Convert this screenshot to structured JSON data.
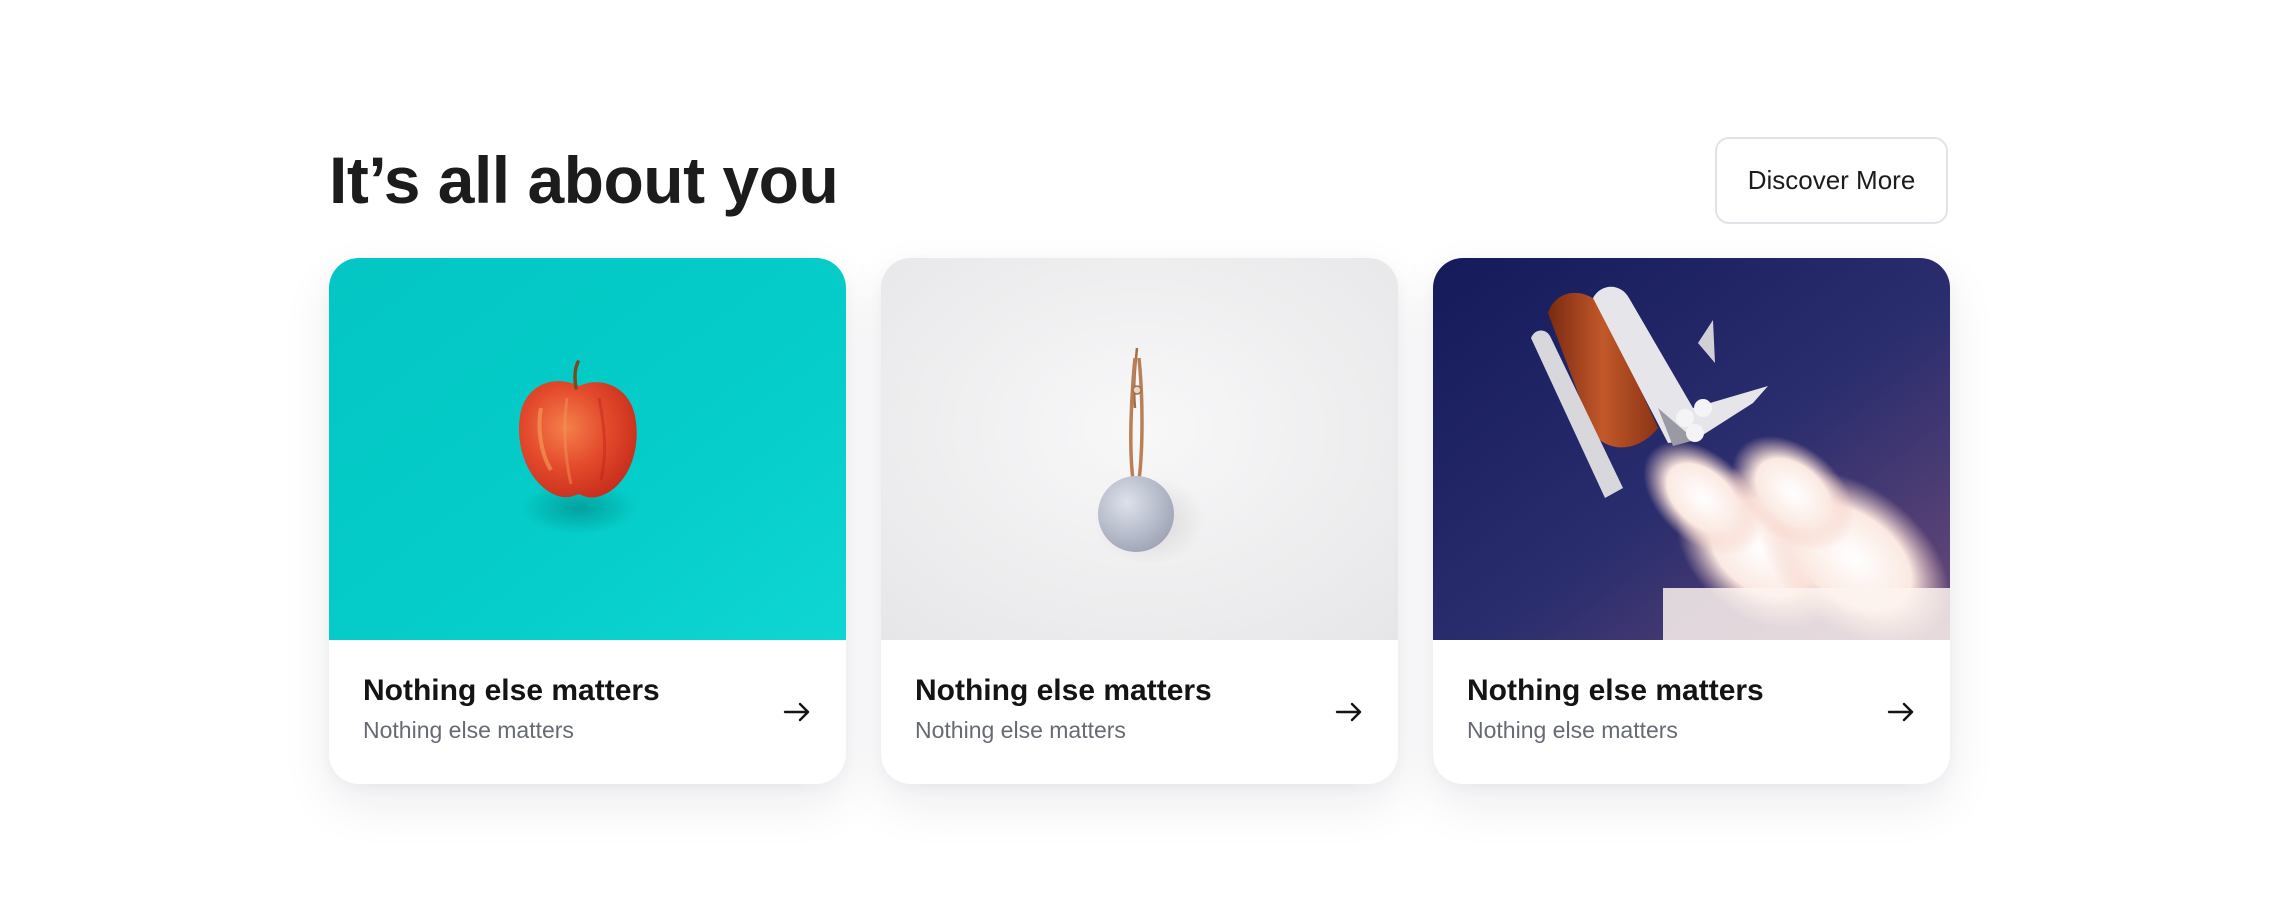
{
  "section": {
    "title": "It’s all about you",
    "discover_label": "Discover More"
  },
  "cards": [
    {
      "title": "Nothing else matters",
      "subtitle": "Nothing else matters",
      "image": "apple-on-teal-photo",
      "arrow_icon": "arrow-right-icon"
    },
    {
      "title": "Nothing else matters",
      "subtitle": "Nothing else matters",
      "image": "smart-speaker-on-white-photo",
      "arrow_icon": "arrow-right-icon"
    },
    {
      "title": "Nothing else matters",
      "subtitle": "Nothing else matters",
      "image": "space-shuttle-launch-photo",
      "arrow_icon": "arrow-right-icon"
    }
  ],
  "colors": {
    "background": "#ffffff",
    "title_text": "#1c1c1c",
    "subtitle_text": "#666a73",
    "button_border": "#e1e3e8",
    "teal": "#05c9c6",
    "night_sky": "#1a2060"
  }
}
